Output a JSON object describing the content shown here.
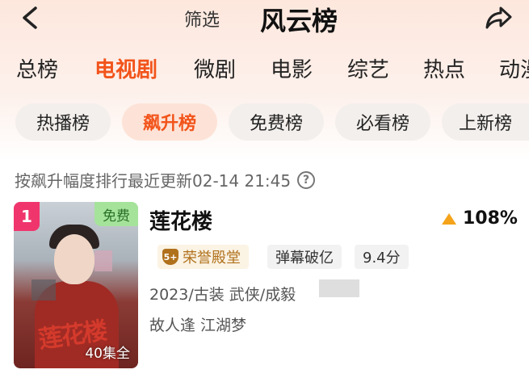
{
  "header": {
    "back_icon": "chevron-left-icon",
    "filter_label": "筛选",
    "title": "风云榜",
    "share_icon": "share-arrow-icon"
  },
  "tabs": [
    {
      "label": "总榜",
      "active": false
    },
    {
      "label": "电视剧",
      "active": true
    },
    {
      "label": "微剧",
      "active": false
    },
    {
      "label": "电影",
      "active": false
    },
    {
      "label": "综艺",
      "active": false
    },
    {
      "label": "热点",
      "active": false
    },
    {
      "label": "动漫",
      "active": false
    }
  ],
  "chips": [
    {
      "label": "热播榜",
      "active": false
    },
    {
      "label": "飙升榜",
      "active": true
    },
    {
      "label": "免费榜",
      "active": false
    },
    {
      "label": "必看榜",
      "active": false
    },
    {
      "label": "上新榜",
      "active": false
    }
  ],
  "info_line": "按飙升幅度排行最近更新02-14 21:45",
  "help_icon": "?",
  "item": {
    "rank": "1",
    "free_badge": "免费",
    "poster_calligraphy": "莲花楼",
    "episodes": "40集全",
    "title": "莲花楼",
    "rise": "108%",
    "rise_icon": "triangle-up-icon",
    "tags": {
      "honor_icon_text": "5+",
      "honor": "荣誉殿堂",
      "barrage": "弹幕破亿",
      "score": "9.4分"
    },
    "meta": "2023/古装 武侠/成毅",
    "tagline": "故人逢 江湖梦"
  },
  "colors": {
    "accent": "#f2541b",
    "rank_badge": "#f0356d",
    "free_badge": "#a5e39b",
    "rise_icon": "#f4a31a",
    "honor": "#b0711c"
  }
}
